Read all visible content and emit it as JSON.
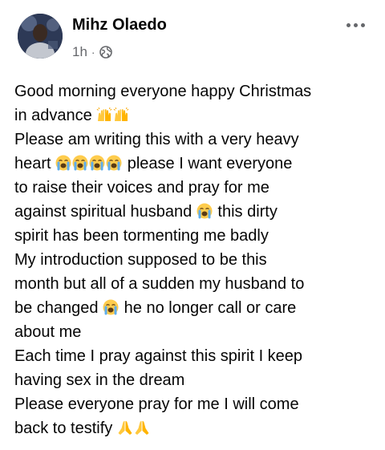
{
  "post": {
    "author": "Mihz Olaedo",
    "time": "1h",
    "separator": "·",
    "privacy_icon": "globe-icon",
    "more_icon": "more-options-icon",
    "lines": {
      "l1": "Good morning everyone happy Christmas",
      "l2": "in advance",
      "l3": "Please am writing this with a very heavy",
      "l4a": "heart",
      "l4b": "please I want everyone",
      "l5": "to raise their voices and pray for me",
      "l6a": "against spiritual husband",
      "l6b": "this dirty",
      "l7": "spirit has been tormenting me badly",
      "l8": "My introduction supposed to be this",
      "l9": "month but all of a sudden my husband to",
      "l10a": "be changed",
      "l10b": " he no longer call or care",
      "l11": "about me",
      "l12": "Each time I pray against this spirit I keep",
      "l13": "having sex in the dream",
      "l14": "Please everyone pray for me I will come",
      "l15": "back to testify"
    },
    "emojis": {
      "raising_hands": "raising-hands-emoji",
      "crying": "loudly-crying-face-emoji",
      "praying": "folded-hands-emoji"
    }
  }
}
